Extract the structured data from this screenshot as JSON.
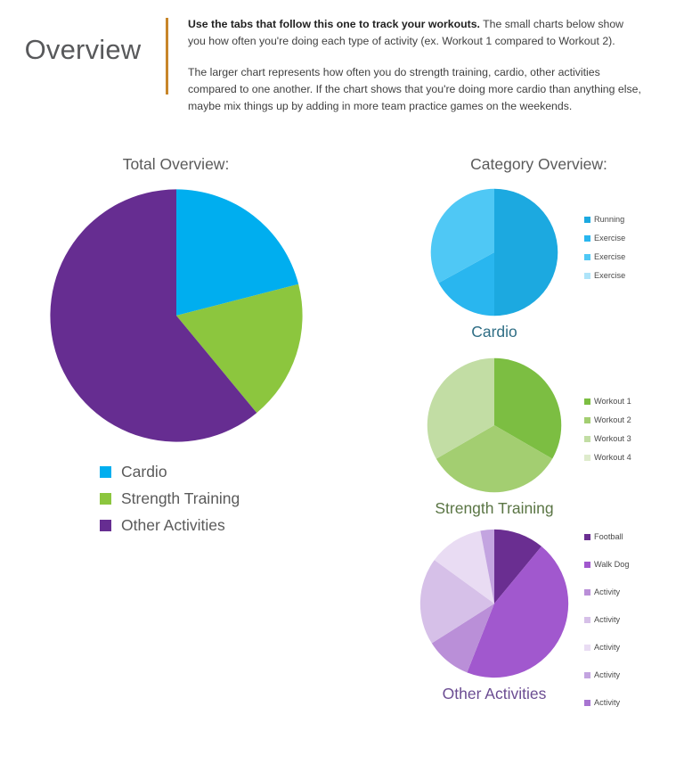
{
  "header": {
    "title": "Overview",
    "accent_color": "#C8862A",
    "paragraph1_bold": "Use the tabs that follow this one to track your workouts.",
    "paragraph1_rest": "  The small charts below show you how often you're doing each type of activity (ex. Workout 1 compared to Workout 2).",
    "paragraph2": "The larger chart represents how often you do strength training, cardio, other activities compared to one another. If the chart shows that you're doing more cardio than anything else, maybe mix things up by adding in more team practice games on the weekends."
  },
  "left": {
    "section_title": "Total Overview:"
  },
  "right": {
    "section_title": "Category Overview:"
  },
  "chart_data": [
    {
      "type": "pie",
      "id": "total-overview",
      "title": "Total Overview:",
      "legend_position": "bottom-left",
      "categories": [
        "Cardio",
        "Strength Training",
        "Other Activities"
      ],
      "values": [
        21,
        18,
        61
      ],
      "colors": [
        "#00AEEF",
        "#8CC63E",
        "#662D91"
      ],
      "start_angle_deg": 0,
      "labels": [
        "Cardio",
        "Strength Training",
        "Other Activities"
      ]
    },
    {
      "type": "pie",
      "id": "cardio",
      "title": "Cardio",
      "title_color": "#2F6E85",
      "legend_position": "right",
      "categories": [
        "Running",
        "Exercise",
        "Exercise",
        "Exercise"
      ],
      "values": [
        50,
        17,
        33,
        0
      ],
      "colors": [
        "#1CA9E0",
        "#29B6EF",
        "#4FC8F5",
        "#AEE4F9"
      ],
      "start_angle_deg": 0
    },
    {
      "type": "pie",
      "id": "strength-training",
      "title": "Strength Training",
      "title_color": "#5A7544",
      "legend_position": "right",
      "categories": [
        "Workout 1",
        "Workout 2",
        "Workout 3",
        "Workout 4"
      ],
      "values": [
        33.3,
        33.3,
        33.3,
        0
      ],
      "colors": [
        "#7CBE42",
        "#A3CE71",
        "#C2DDA4",
        "#DEEBCC"
      ],
      "start_angle_deg": 0
    },
    {
      "type": "pie",
      "id": "other-activities",
      "title": "Other Activities",
      "title_color": "#6B4C92",
      "legend_position": "right",
      "categories": [
        "Football",
        "Walk Dog",
        "Activity",
        "Activity",
        "Activity",
        "Activity",
        "Activity"
      ],
      "values": [
        11,
        45,
        10,
        19,
        12,
        3,
        0
      ],
      "colors": [
        "#6A2E91",
        "#A158CE",
        "#BA8FD8",
        "#D6C0E8",
        "#E9DCF3",
        "#C3A4E0",
        "#A875D1"
      ],
      "start_angle_deg": 0
    }
  ]
}
